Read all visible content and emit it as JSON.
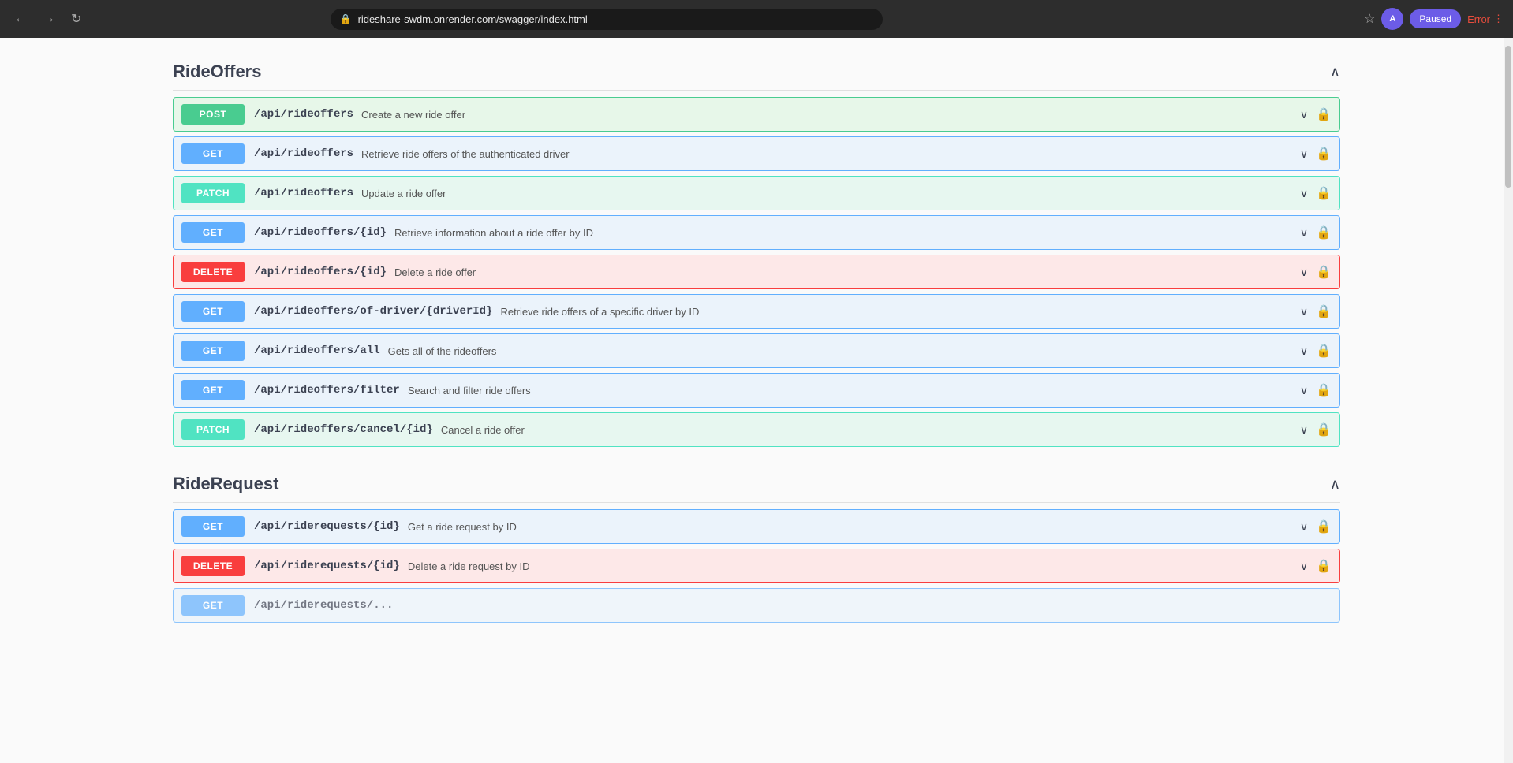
{
  "browser": {
    "url": "rideshare-swdm.onrender.com/swagger/index.html",
    "paused_label": "Paused",
    "error_label": "Error",
    "profile_initial": "A"
  },
  "sections": [
    {
      "id": "ride-offers",
      "title": "RideOffers",
      "expanded": true,
      "endpoints": [
        {
          "method": "POST",
          "path": "/api/rideoffers",
          "description": "Create a new ride offer",
          "locked": true
        },
        {
          "method": "GET",
          "path": "/api/rideoffers",
          "description": "Retrieve ride offers of the authenticated driver",
          "locked": true
        },
        {
          "method": "PATCH",
          "path": "/api/rideoffers",
          "description": "Update a ride offer",
          "locked": true
        },
        {
          "method": "GET",
          "path": "/api/rideoffers/{id}",
          "description": "Retrieve information about a ride offer by ID",
          "locked": true
        },
        {
          "method": "DELETE",
          "path": "/api/rideoffers/{id}",
          "description": "Delete a ride offer",
          "locked": true
        },
        {
          "method": "GET",
          "path": "/api/rideoffers/of-driver/{driverId}",
          "description": "Retrieve ride offers of a specific driver by ID",
          "locked": true
        },
        {
          "method": "GET",
          "path": "/api/rideoffers/all",
          "description": "Gets all of the rideoffers",
          "locked": true
        },
        {
          "method": "GET",
          "path": "/api/rideoffers/filter",
          "description": "Search and filter ride offers",
          "locked": true
        },
        {
          "method": "PATCH",
          "path": "/api/rideoffers/cancel/{id}",
          "description": "Cancel a ride offer",
          "locked": true
        }
      ]
    },
    {
      "id": "ride-request",
      "title": "RideRequest",
      "expanded": true,
      "endpoints": [
        {
          "method": "GET",
          "path": "/api/riderequests/{id}",
          "description": "Get a ride request by ID",
          "locked": true
        },
        {
          "method": "DELETE",
          "path": "/api/riderequests/{id}",
          "description": "Delete a ride request by ID",
          "locked": true
        },
        {
          "method": "GET",
          "path": "/api/riderequests/...",
          "description": "",
          "locked": true,
          "partial": true
        }
      ]
    }
  ]
}
